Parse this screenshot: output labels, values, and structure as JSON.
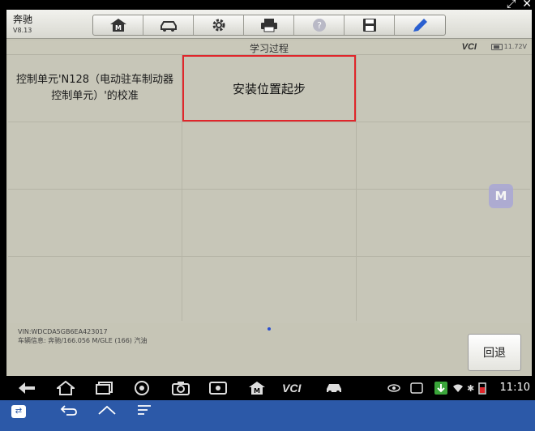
{
  "window": {
    "icons": [
      "expand-icon",
      "close-icon"
    ]
  },
  "header": {
    "brand": "奔驰",
    "version": "V8.13",
    "tools": [
      "home-icon",
      "vehicle-icon",
      "settings-icon",
      "print-icon",
      "help-icon",
      "save-icon",
      "pen-icon"
    ]
  },
  "titlebar": {
    "title": "学习过程",
    "vcl": "VCI",
    "voltage": "11.72V"
  },
  "grid": {
    "cell1": "控制单元'N128（电动驻车制动器控制单元）'的校准",
    "cell2": "安装位置起步"
  },
  "info": {
    "vin": "VIN:WDCDA5GB6EA423017",
    "vehicle": "车辆信息: 奔驰/166.056 M/GLE (166) 汽油"
  },
  "back_button": "回退",
  "clock": "11:10",
  "colors": {
    "highlight": "#e0262b",
    "system_bar": "#2c59a8",
    "background": "#c6c5b6"
  }
}
